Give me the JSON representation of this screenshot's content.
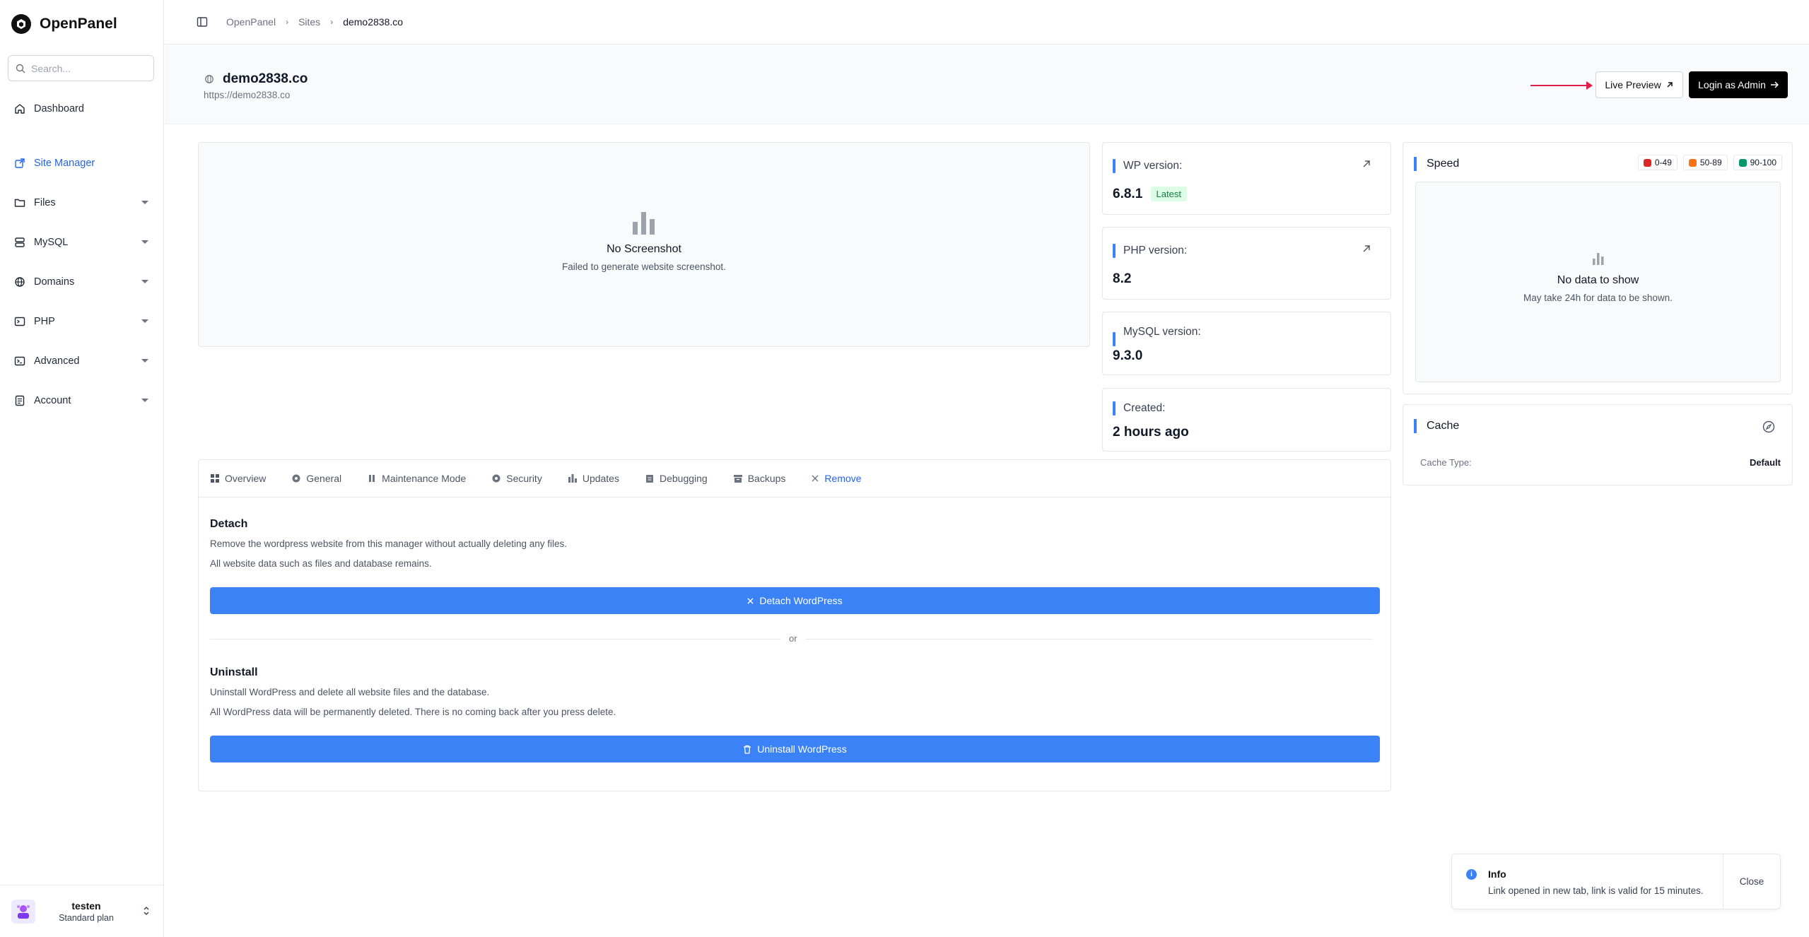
{
  "brand": {
    "name": "OpenPanel"
  },
  "search": {
    "placeholder": "Search..."
  },
  "nav": {
    "dashboard": "Dashboard",
    "site_manager": "Site Manager",
    "files": "Files",
    "mysql": "MySQL",
    "domains": "Domains",
    "php": "PHP",
    "advanced": "Advanced",
    "account": "Account"
  },
  "user": {
    "name": "testen",
    "plan": "Standard plan"
  },
  "breadcrumb": [
    "OpenPanel",
    "Sites",
    "demo2838.co"
  ],
  "site": {
    "name": "demo2838.co",
    "url": "https://demo2838.co"
  },
  "header_actions": {
    "live_preview": "Live Preview",
    "login_admin": "Login as Admin"
  },
  "screenshot": {
    "title": "No Screenshot",
    "subtitle": "Failed to generate website screenshot."
  },
  "stats": {
    "wp": {
      "label": "WP version:",
      "value": "6.8.1",
      "badge": "Latest"
    },
    "php": {
      "label": "PHP version:",
      "value": "8.2"
    },
    "mysql": {
      "label": "MySQL version:",
      "value": "9.3.0"
    },
    "created": {
      "label": "Created:",
      "value": "2 hours ago"
    }
  },
  "speed": {
    "title": "Speed",
    "legend": [
      {
        "label": "0-49",
        "color": "#dc2626"
      },
      {
        "label": "50-89",
        "color": "#f97316"
      },
      {
        "label": "90-100",
        "color": "#059669"
      }
    ],
    "empty_title": "No data to show",
    "empty_subtitle": "May take 24h for data to be shown."
  },
  "cache": {
    "title": "Cache",
    "type_label": "Cache Type:",
    "type_value": "Default"
  },
  "tabs": [
    "Overview",
    "General",
    "Maintenance Mode",
    "Security",
    "Updates",
    "Debugging",
    "Backups",
    "Remove"
  ],
  "active_tab": "Remove",
  "remove": {
    "detach_title": "Detach",
    "detach_text_1": "Remove the wordpress website from this manager without actually deleting any files.",
    "detach_text_2": "All website data such as files and database remains.",
    "detach_button": "Detach WordPress",
    "or": "or",
    "uninstall_title": "Uninstall",
    "uninstall_text_1": "Uninstall WordPress and delete all website files and the database.",
    "uninstall_text_2": "All WordPress data will be permanently deleted. There is no coming back after you press delete.",
    "uninstall_button": "Uninstall WordPress"
  },
  "toast": {
    "title": "Info",
    "message": "Link opened in new tab, link is valid for 15 minutes.",
    "close": "Close"
  },
  "colors": {
    "accent": "#3b82f6",
    "active_nav": "#2563eb",
    "primary_dark": "#000000",
    "annotation_arrow": "#e11d48"
  }
}
